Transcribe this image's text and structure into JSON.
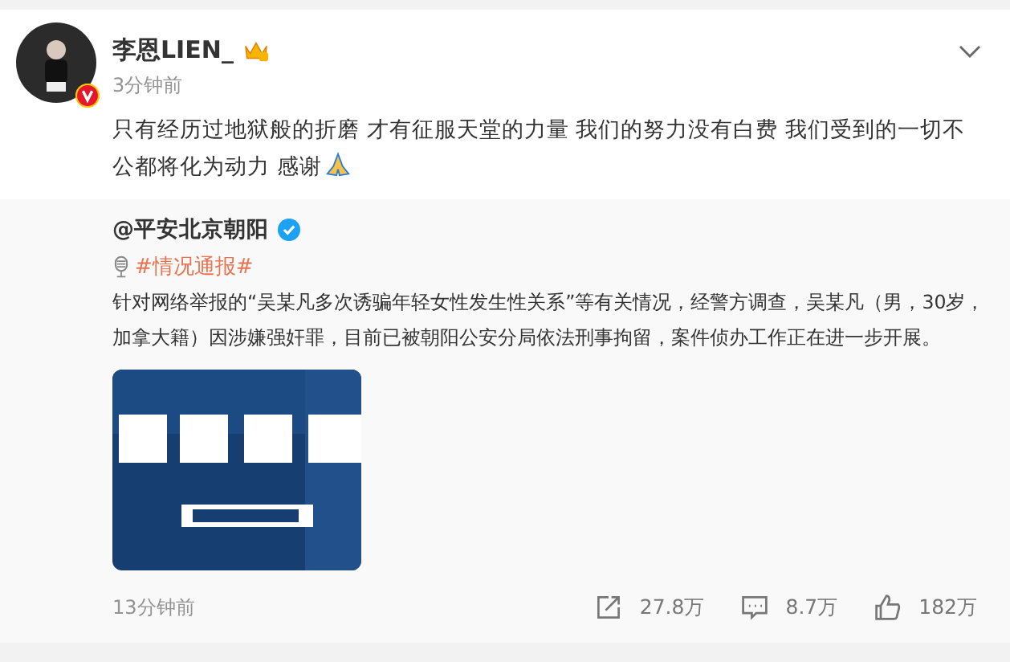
{
  "post": {
    "author": "李恩LIEN_",
    "time": "3分钟前",
    "text_lines": [
      "只有经历过地狱般的折磨 才有征服天堂的力量 我们的努力没有白费 我们受到的一切不",
      "公都将化为动力 感谢"
    ]
  },
  "repost": {
    "author": "@平安北京朝阳",
    "hashtag": "#情况通报#",
    "text": "针对网络举报的“吴某凡多次诱骗年轻女性发生性关系”等有关情况，经警方调查，吴某凡（男，30岁，加拿大籍）因涉嫌强奸罪，目前已被朝阳公安分局依法刑事拘留，案件侦办工作正在进一步开展。",
    "time": "13分钟前",
    "actions": [
      {
        "kind": "share",
        "count": "27.8万"
      },
      {
        "kind": "comment",
        "count": "8.7万"
      },
      {
        "kind": "like",
        "count": "182万"
      }
    ]
  }
}
